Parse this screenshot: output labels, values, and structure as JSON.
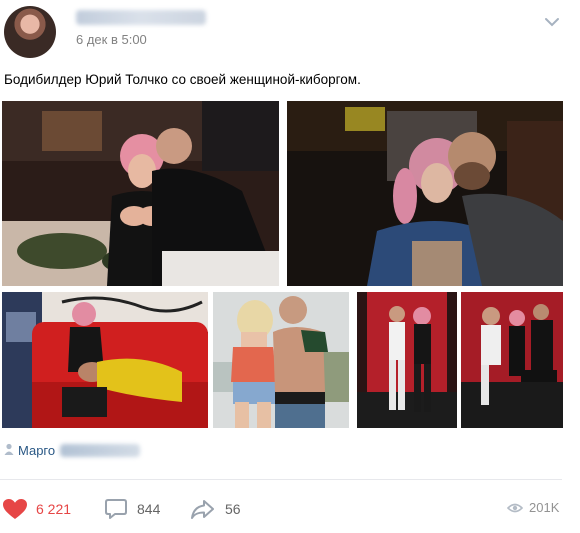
{
  "post": {
    "date": "6 дек в 5:00",
    "text": "Бодибилдер Юрий Толчко со своей женщиной-киборгом."
  },
  "source": {
    "name": "Марго"
  },
  "actions": {
    "likes": "6 221",
    "comments": "844",
    "shares": "56",
    "views": "201K"
  },
  "colors": {
    "like_accent": "#e64646",
    "link": "#2a5885",
    "meta_text": "#828282"
  },
  "icons": {
    "like": "heart-icon",
    "comment": "comment-icon",
    "share": "share-icon",
    "views": "eye-icon",
    "menu": "chevron-down-icon",
    "source": "person-icon"
  }
}
